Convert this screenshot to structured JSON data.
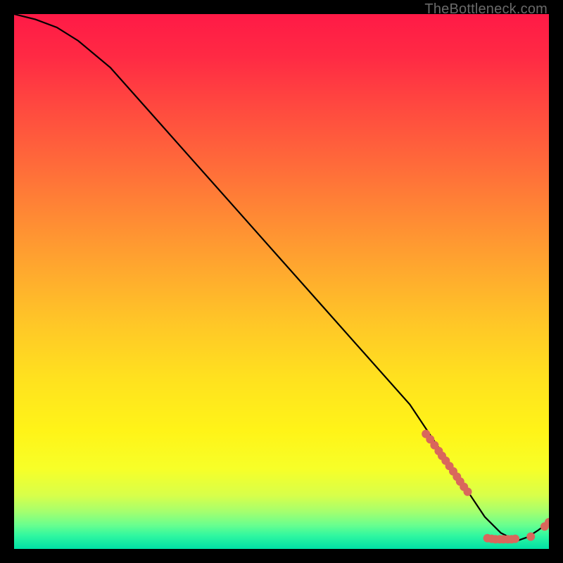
{
  "watermark": "TheBottleneck.com",
  "chart_data": {
    "type": "line",
    "title": "",
    "xlabel": "",
    "ylabel": "",
    "xlim": [
      0,
      100
    ],
    "ylim": [
      0,
      100
    ],
    "grid": false,
    "series": [
      {
        "name": "curve",
        "color": "#000000",
        "x": [
          0,
          4,
          8,
          12,
          18,
          26,
          34,
          42,
          50,
          58,
          66,
          74,
          80,
          84,
          88,
          91,
          94,
          96,
          98,
          100
        ],
        "y": [
          100,
          99,
          97.5,
          95,
          90,
          81,
          72,
          63,
          54,
          45,
          36,
          27,
          18,
          12,
          6,
          3,
          1.5,
          2.2,
          3.5,
          5
        ]
      }
    ],
    "markers": [
      {
        "name": "cloud-upper",
        "shape": "circle",
        "color": "#d9675c",
        "r": 6,
        "points": [
          {
            "x": 77.0,
            "y": 21.5
          },
          {
            "x": 77.8,
            "y": 20.5
          },
          {
            "x": 78.6,
            "y": 19.4
          },
          {
            "x": 79.4,
            "y": 18.3
          },
          {
            "x": 80.0,
            "y": 17.4
          },
          {
            "x": 80.7,
            "y": 16.5
          },
          {
            "x": 81.4,
            "y": 15.5
          },
          {
            "x": 82.1,
            "y": 14.5
          },
          {
            "x": 82.8,
            "y": 13.5
          },
          {
            "x": 83.4,
            "y": 12.6
          },
          {
            "x": 84.1,
            "y": 11.6
          },
          {
            "x": 84.8,
            "y": 10.7
          }
        ]
      },
      {
        "name": "cloud-lower",
        "shape": "circle",
        "color": "#d9675c",
        "r": 6,
        "points": [
          {
            "x": 88.5,
            "y": 2.0
          },
          {
            "x": 89.3,
            "y": 1.9
          },
          {
            "x": 90.0,
            "y": 1.8
          },
          {
            "x": 90.8,
            "y": 1.8
          },
          {
            "x": 91.5,
            "y": 1.8
          },
          {
            "x": 92.3,
            "y": 1.8
          },
          {
            "x": 93.0,
            "y": 1.8
          },
          {
            "x": 93.7,
            "y": 1.9
          },
          {
            "x": 96.6,
            "y": 2.3
          }
        ]
      },
      {
        "name": "tail-dots",
        "shape": "circle",
        "color": "#d9675c",
        "r": 6,
        "points": [
          {
            "x": 99.2,
            "y": 4.2
          },
          {
            "x": 100.0,
            "y": 5.0
          }
        ]
      }
    ],
    "background_gradient": {
      "direction": "vertical",
      "stops": [
        {
          "pos": 0.0,
          "color": "#ff1a46"
        },
        {
          "pos": 0.38,
          "color": "#ff8a34"
        },
        {
          "pos": 0.78,
          "color": "#fff418"
        },
        {
          "pos": 0.93,
          "color": "#a5ff6e"
        },
        {
          "pos": 1.0,
          "color": "#00e0a5"
        }
      ]
    }
  }
}
